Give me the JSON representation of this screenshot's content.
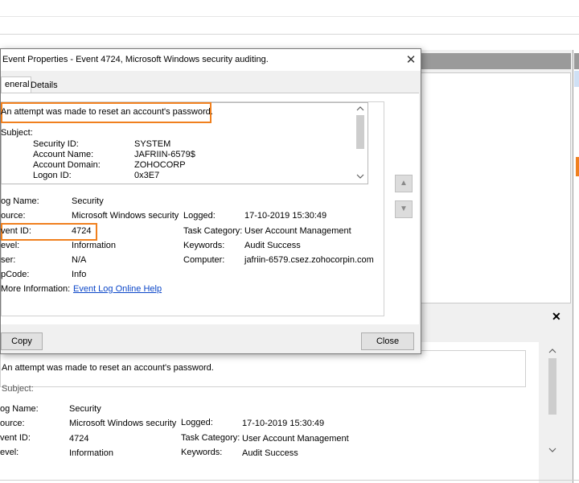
{
  "dialog": {
    "title": "Event Properties - Event 4724, Microsoft Windows security auditing.",
    "tabs": [
      {
        "label": "eneral"
      },
      {
        "label": "Details"
      }
    ],
    "description": "An attempt was made to reset an account's password.",
    "subject_label": "Subject:",
    "subject": {
      "security_id_label": "Security ID:",
      "security_id": "SYSTEM",
      "account_name_label": "Account Name:",
      "account_name": "JAFRIIN-6579$",
      "account_domain_label": "Account Domain:",
      "account_domain": "ZOHOCORP",
      "logon_id_label": "Logon ID:",
      "logon_id": "0x3E7"
    },
    "fields": {
      "log_name_label": "og Name:",
      "log_name": "Security",
      "source_label": "ource:",
      "source": "Microsoft Windows security a",
      "logged_label": "Logged:",
      "logged": "17-10-2019 15:30:49",
      "event_id_label": "vent ID:",
      "event_id": "4724",
      "task_category_label": "Task Category:",
      "task_category": "User Account Management",
      "level_label": "evel:",
      "level": "Information",
      "keywords_label": "Keywords:",
      "keywords": "Audit Success",
      "user_label": "ser:",
      "user": "N/A",
      "computer_label": "Computer:",
      "computer": "jafriin-6579.csez.zohocorpin.com",
      "opcode_label": "pCode:",
      "opcode": "Info",
      "more_info_label": "More Information:",
      "more_info_link": "Event Log Online Help"
    },
    "copy_button": "Copy",
    "close_button": "Close"
  },
  "preview": {
    "close_icon": "✕",
    "description": "An attempt was made to reset an account's password.",
    "subject_label": "Subject:",
    "log_name_label": "og Name:",
    "log_name": "Security",
    "source_label": "ource:",
    "source": "Microsoft Windows security a",
    "logged_label": "Logged:",
    "logged": "17-10-2019 15:30:49",
    "event_id_label": "vent ID:",
    "event_id": "4724",
    "task_category_label": "Task Category:",
    "task_category": "User Account Management",
    "level_label": "evel:",
    "level": "Information",
    "keywords_label": "Keywords:",
    "keywords": "Audit Success"
  },
  "colors": {
    "highlight": "#f0801e",
    "link": "#0b46c8"
  }
}
